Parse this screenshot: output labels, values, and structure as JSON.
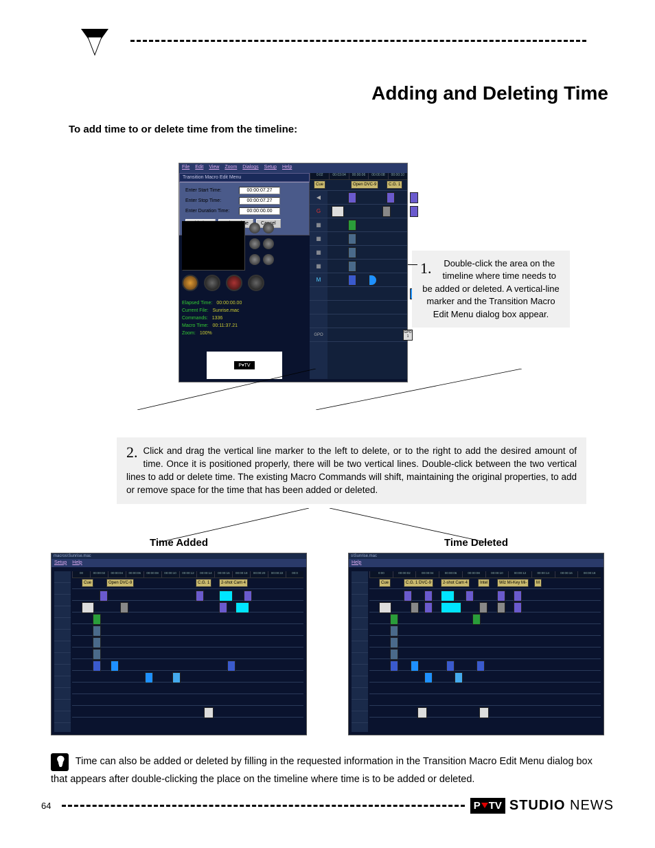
{
  "header": {
    "title": "Adding and Deleting Time"
  },
  "intro": "To add time to or delete time from the timeline:",
  "app": {
    "menu": [
      "File",
      "Edit",
      "View",
      "Zoom",
      "Dialogs",
      "Setup",
      "Help"
    ],
    "dialog": {
      "title": "Transition Macro Edit Menu",
      "fields": {
        "start_label": "Enter Start Time:",
        "start_val": "00:00:07.27",
        "stop_label": "Enter Stop Time:",
        "stop_val": "00:00:07.27",
        "dur_label": "Enter Duration Time:",
        "dur_val": "00:00:00.00"
      },
      "buttons": {
        "add": "Add Time",
        "del": "Delete Time",
        "cancel": "Cancel"
      }
    },
    "ruler": [
      "0:02",
      "00:03:04",
      "00:00:06",
      "00:00:08",
      "00:00:10"
    ],
    "tags": {
      "cue": "Cue",
      "open": "Open DVC-9",
      "cg": "C.G. 1"
    },
    "stats": {
      "elapsed_l": "Elapsed Time:",
      "elapsed_v": "00:00:00.00",
      "file_l": "Current File:",
      "file_v": "Sunrise.mac",
      "cmd_l": "Commands:",
      "cmd_v": "1336",
      "macro_l": "Macro Time:",
      "macro_v": "00:11:37.21",
      "zoom_l": "Zoom:",
      "zoom_v": "100%"
    },
    "ptv_chip": "P▾TV"
  },
  "step1": {
    "num": "1.",
    "text": "Double-click the area on the timeline where time needs to be added or deleted. A vertical-line marker and the Transition Macro Edit Menu dialog box appear."
  },
  "step2": {
    "num": "2.",
    "text": "Click and drag the vertical line marker to the left to delete, or to the right to add the desired amount of time. Once it is positioned properly, there will be two vertical lines.  Double-click between the two vertical lines to add or delete time. The existing Macro Commands will shift, maintaining the original properties, to add or remove space for the time that has been added or deleted."
  },
  "cols": {
    "added": "Time Added",
    "deleted": "Time Deleted"
  },
  "shot_added": {
    "path": "macros\\Sunrise.mac",
    "menu": [
      "Setup",
      "Help"
    ],
    "ruler": [
      "00",
      "00:00:02",
      "00:00:04",
      "00:00:06",
      "00:00:08",
      "00:00:10",
      "00:00:12",
      "00:00:14",
      "00:00:16",
      "00:00:18",
      "00:00:20",
      "00:00:22",
      "00:0"
    ],
    "tags": {
      "cue": "Cue",
      "open": "Open DVC-9",
      "cg": "C.G. 1",
      "shot": "2-shot Cam 4"
    }
  },
  "shot_deleted": {
    "path": "s\\Sunrise.mac",
    "menu": [
      "Help"
    ],
    "ruler": [
      "0:00",
      "00:00:02",
      "00:00:04",
      "00:00:06",
      "00:00:08",
      "00:00:10",
      "00:00:12",
      "00:00:14",
      "00:00:16",
      "00:00:18"
    ],
    "tags": {
      "cue": "Cue",
      "cg": "C.G. 1  DVC-9",
      "shot": "2-shot Cam 4",
      "intel": "Intel",
      "wiz": "Wiz Mi-Key Mi-",
      "m": "M"
    }
  },
  "tip": "Time can also be added or deleted by filling in the requested information in the Transition Macro Edit Menu dialog box that appears after double-clicking the place on the timeline where time is to be added or deleted.",
  "footer": {
    "page": "64",
    "brand_p": "P",
    "brand_tv": "TV",
    "studio": "STUDIO",
    "news": " NEWS"
  }
}
